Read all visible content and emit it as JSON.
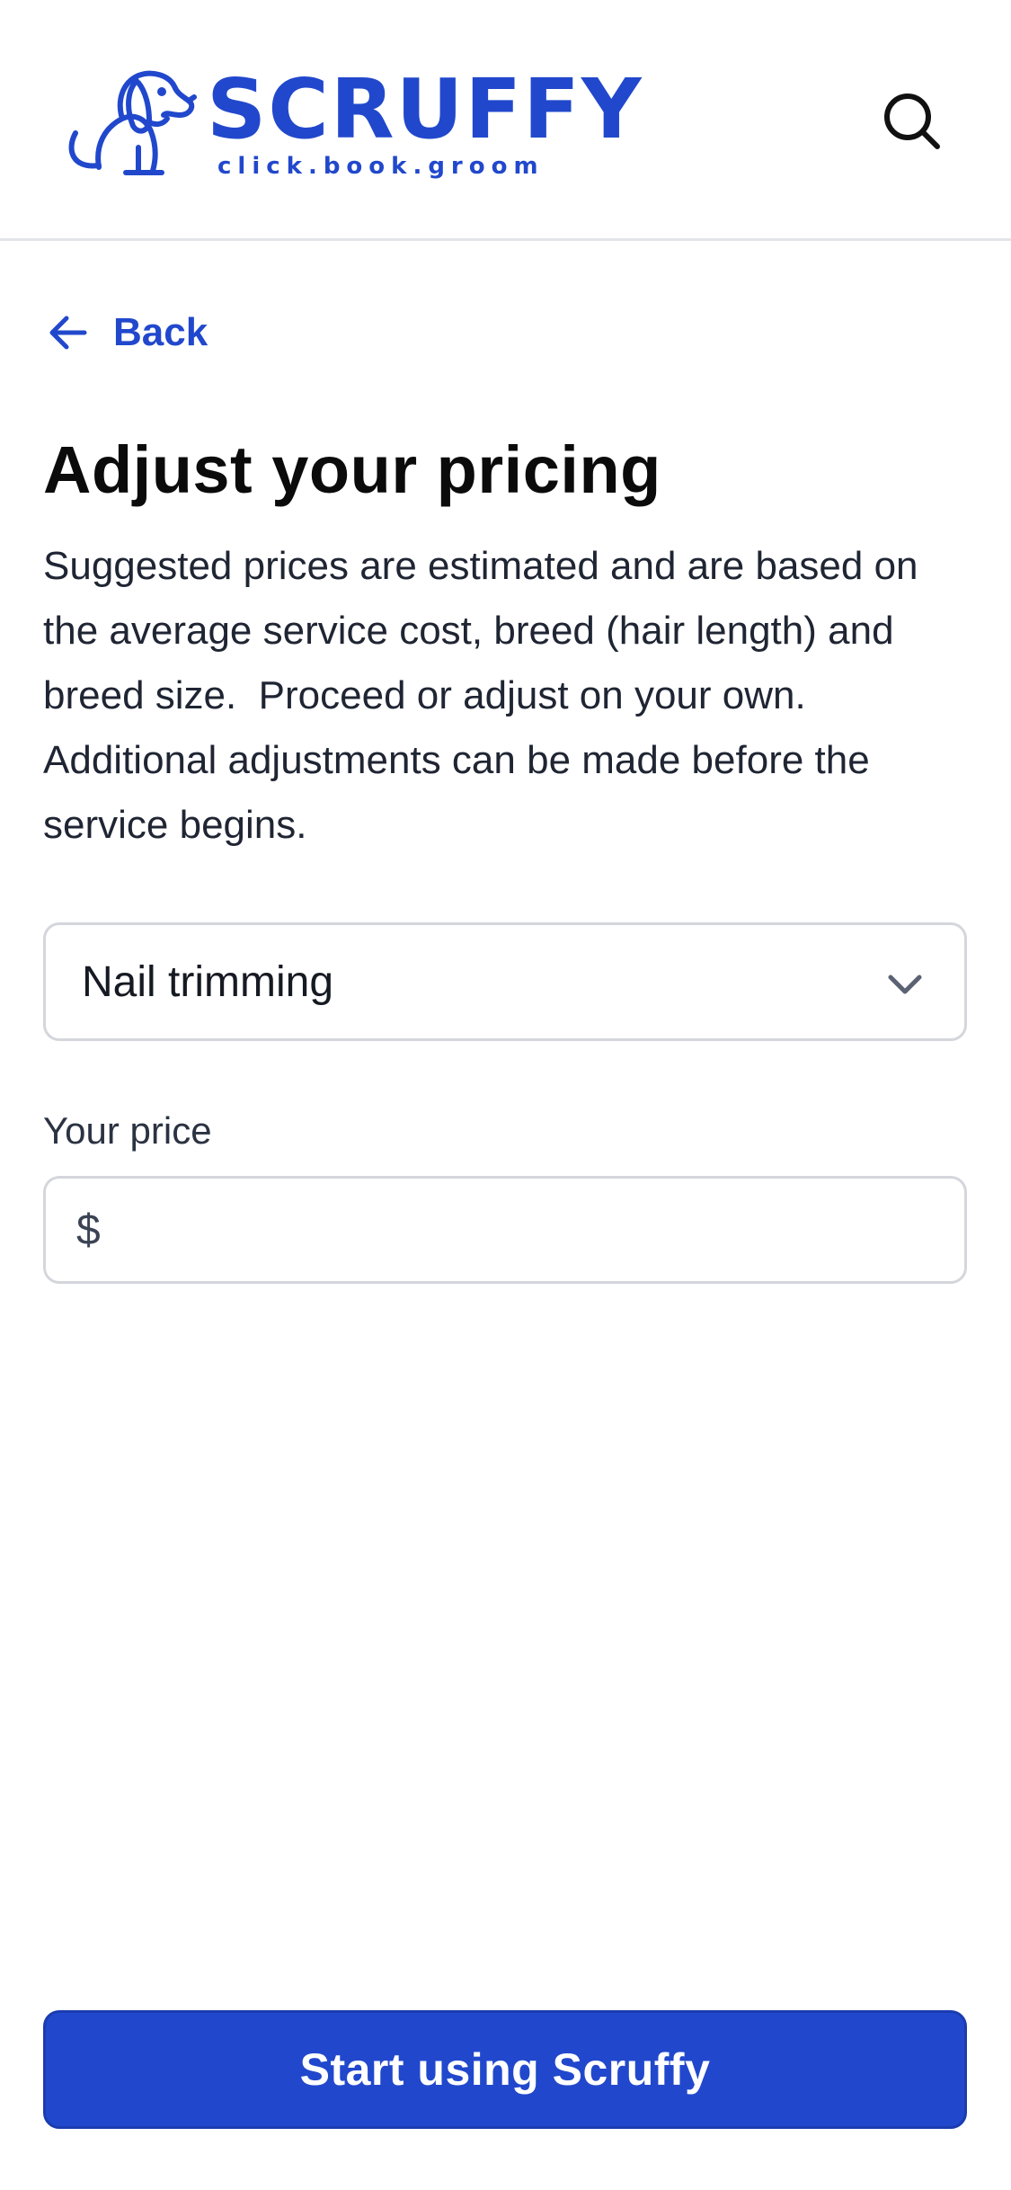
{
  "header": {
    "logo": {
      "wordmark": "SCRUFFY",
      "tagline": "click.book.groom",
      "icon": "dog-mascot-icon"
    },
    "search_icon": "search-icon"
  },
  "nav": {
    "back_label": "Back",
    "back_icon": "arrow-left-icon"
  },
  "main": {
    "title": "Adjust your pricing",
    "description": "Suggested prices are estimated and are based on the average service cost, breed (hair length) and breed size.  Proceed or adjust on your own. Additional adjustments can be made before the service begins.",
    "service_select": {
      "selected": "Nail trimming",
      "icon": "chevron-down-icon"
    },
    "price_field": {
      "label": "Your price",
      "currency_symbol": "$",
      "value": ""
    }
  },
  "footer": {
    "primary_button_label": "Start using Scruffy"
  },
  "colors": {
    "brand": "#2148cc",
    "border": "#d4d6dc",
    "text": "#111111"
  }
}
